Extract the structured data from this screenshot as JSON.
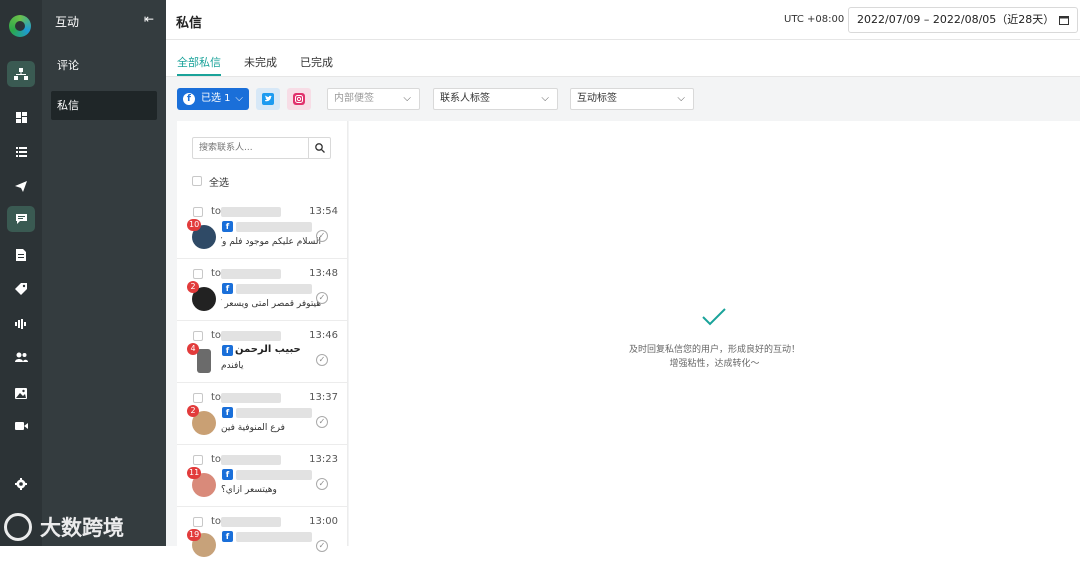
{
  "rail": {
    "items": [
      {
        "icon": "org-chart-icon"
      },
      {
        "icon": "dashboard-icon"
      },
      {
        "icon": "list-icon"
      },
      {
        "icon": "send-icon"
      },
      {
        "icon": "message-icon"
      },
      {
        "icon": "document-icon"
      },
      {
        "icon": "tag-icon"
      },
      {
        "icon": "audio-bars-icon"
      },
      {
        "icon": "users-icon"
      },
      {
        "icon": "image-icon"
      },
      {
        "icon": "video-icon"
      },
      {
        "icon": "settings-icon"
      }
    ]
  },
  "sidebar": {
    "title": "互动",
    "collapse_icon": "collapse-left-icon",
    "items": [
      {
        "label": "评论"
      },
      {
        "label": "私信"
      }
    ]
  },
  "watermark": "大数跨境",
  "header": {
    "title": "私信",
    "timezone": "UTC +08:00",
    "date_range": "2022/07/09 – 2022/08/05（近28天）",
    "calendar_icon": "calendar-icon"
  },
  "tabs": [
    {
      "label": "全部私信"
    },
    {
      "label": "未完成"
    },
    {
      "label": "已完成"
    }
  ],
  "filters": {
    "selected_label": "已选 1",
    "internal_note_placeholder": "内部便签",
    "contact_tag_label": "联系人标签",
    "interaction_tag_label": "互动标签"
  },
  "search": {
    "placeholder": "搜索联系人..."
  },
  "select_all_label": "全选",
  "conversations": [
    {
      "prefix": "to",
      "time": "13:54",
      "badge": "10",
      "message": "السلام عليكم موجود فلم وكيبو",
      "name": ""
    },
    {
      "prefix": "to",
      "time": "13:48",
      "badge": "2",
      "message": "هيتوفر قمصر امتى ويسعر كام",
      "name": ""
    },
    {
      "prefix": "to",
      "time": "13:46",
      "badge": "4",
      "message": "يافندم",
      "name": "حبيب الرحمن"
    },
    {
      "prefix": "to",
      "time": "13:37",
      "badge": "2",
      "message": "فرع المنوفية فين",
      "name": ""
    },
    {
      "prefix": "to",
      "time": "13:23",
      "badge": "11",
      "message": "وهيتسعر ازاي؟",
      "name": ""
    },
    {
      "prefix": "to",
      "time": "13:00",
      "badge": "19",
      "message": "",
      "name": ""
    }
  ],
  "empty_state": {
    "line1": "及时回复私信您的用户，形成良好的互动！",
    "line2": "增强粘性，达成转化～"
  },
  "colors": {
    "accent": "#1aa39a",
    "facebook": "#1a6fd9",
    "rail": "#2c3336",
    "sidebar": "#343c3f"
  }
}
